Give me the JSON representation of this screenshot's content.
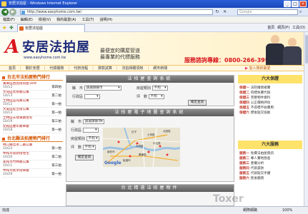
{
  "window": {
    "title": "安居法拍屋 - Windows Internet Explorer",
    "minimize": "_",
    "maximize": "□",
    "close": "×"
  },
  "address": {
    "url": "http://www.easyhome.com.tw/",
    "search_placeholder": "Google"
  },
  "menu": [
    "檔案(F)",
    "編輯(E)",
    "檢視(V)",
    "我的最愛(A)",
    "工具(T)",
    "說明(H)"
  ],
  "tab": {
    "label": "安居法拍屋"
  },
  "commands": [
    "首頁",
    "網頁(P)",
    "工具(O)"
  ],
  "site": {
    "logo_mark": "A",
    "logo_name": "安居法拍屋",
    "logo_url": "www.easyhome.com.tw",
    "slogan1": "最便宜的購屋管道",
    "slogan2": "最專業的代標服務",
    "hotline": "服務諮詢專線：0800-266-399"
  },
  "nav": [
    "首頁",
    "關於安居",
    "代標服務",
    "代辦流程",
    "貸款試算",
    "法拍相關須知",
    "網市新聞"
  ],
  "fav_join": "加入我的最愛",
  "left": {
    "hot1_title": "台北市法拍屋熱門排行",
    "hot1": [
      {
        "title": "萬華區西昌街房屋16坪",
        "date": "10/12",
        "price": "第四拍"
      },
      {
        "title": "大同區太原路公寓",
        "date": "10/13",
        "price": "第二拍"
      },
      {
        "title": "士林區莒光路公寓",
        "date": "10/12",
        "price": "第一拍"
      },
      {
        "title": "大安區延吉街公寓",
        "date": "10/13",
        "price": "第一拍"
      },
      {
        "title": "士林區天母東路住宅",
        "date": "10/19",
        "price": "第三拍"
      },
      {
        "title": "北投區豐年路華廈",
        "date": "10/18",
        "price": "第一拍"
      }
    ],
    "hot2_title": "台北縣法拍屋熱門排行",
    "hot2": [
      {
        "title": "林口鄉忠孝二路公寓",
        "date": "10/23",
        "price": "第一拍"
      },
      {
        "title": "中和市景新街住宅",
        "date": "10/20",
        "price": "第二拍"
      },
      {
        "title": "永和市竹林路公寓",
        "date": "10/11",
        "price": "第三拍"
      },
      {
        "title": "中和市民享街華廈",
        "date": "10/29",
        "price": "第一拍"
      }
    ]
  },
  "center": {
    "panel1_title": "法拍屋查詢系統",
    "city_label": "縣　市",
    "city_value": "請選擇縣市",
    "type_label": "房屋類別",
    "type_value": "不拘",
    "district_label": "行政區",
    "district_value": "",
    "ping_label": "坪　數",
    "ping_value": "不拘",
    "search_btn": "確定查詢",
    "panel2_title": "法拍屋電子地圖查詢系統",
    "city2_value": "請選擇縣市",
    "district2_value": "",
    "type2_value": "不拘",
    "ping2_value": "不拘",
    "search2_btn": "確定查詢",
    "map_labels": [
      "社子",
      "士林區",
      "北投區",
      "大同區",
      "中山區",
      "萬華區",
      "板橋市",
      "新莊市"
    ],
    "google": "Google",
    "panel3_title": "台北精選法拍屋物件"
  },
  "right": {
    "box1_title": "六大保證",
    "box1": [
      {
        "k": "保證一",
        "v": "法院權狀確實"
      },
      {
        "k": "保證二",
        "v": "得標免費代辦"
      },
      {
        "k": "保證三",
        "v": "完整物件資料"
      },
      {
        "k": "保證四",
        "v": "公正價格評估"
      },
      {
        "k": "保證五",
        "v": "不得標不收費用"
      },
      {
        "k": "保證六",
        "v": "標後點交協助"
      }
    ],
    "box2_title": "六大服務",
    "box2": [
      {
        "k": "服務一",
        "v": "免費法拍屋資訊"
      },
      {
        "k": "服務二",
        "v": "專人實地勘查"
      },
      {
        "k": "服務三",
        "v": "產權分析"
      },
      {
        "k": "服務四",
        "v": "代辦貸款"
      },
      {
        "k": "服務五",
        "v": "代辦點交手續"
      },
      {
        "k": "服務六",
        "v": "售後服務"
      }
    ]
  },
  "status": {
    "done": "完成",
    "zone": "網際網路",
    "zoom": "100%",
    "watermark": "Toxer"
  },
  "colors": {
    "brand_red": "#d9161c",
    "brand_navy": "#1c2a7a",
    "accent_orange": "#e37a1c",
    "highlight_yellow": "#ffe26a"
  }
}
